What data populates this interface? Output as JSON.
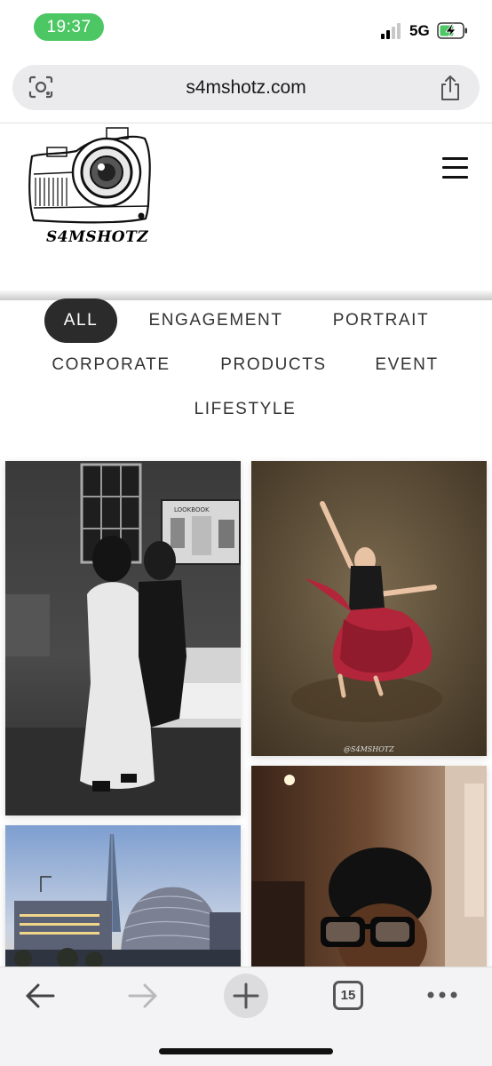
{
  "status_bar": {
    "time": "19:37",
    "network": "5G"
  },
  "browser": {
    "url": "s4mshotz.com",
    "tab_count": "15"
  },
  "site": {
    "logo_text": "S4MSHOTZ"
  },
  "filters": {
    "all": "ALL",
    "engagement": "ENGAGEMENT",
    "portrait": "PORTRAIT",
    "corporate": "CORPORATE",
    "products": "PRODUCTS",
    "event": "EVENT",
    "lifestyle": "LIFESTYLE"
  },
  "gallery": {
    "watermark": "@S4MSHOTZ",
    "lookbook_text": "LOOKBOOK"
  },
  "colors": {
    "active_filter": "#2b2b2b",
    "time_pill": "#4cc764",
    "dress": "#b3253a"
  }
}
